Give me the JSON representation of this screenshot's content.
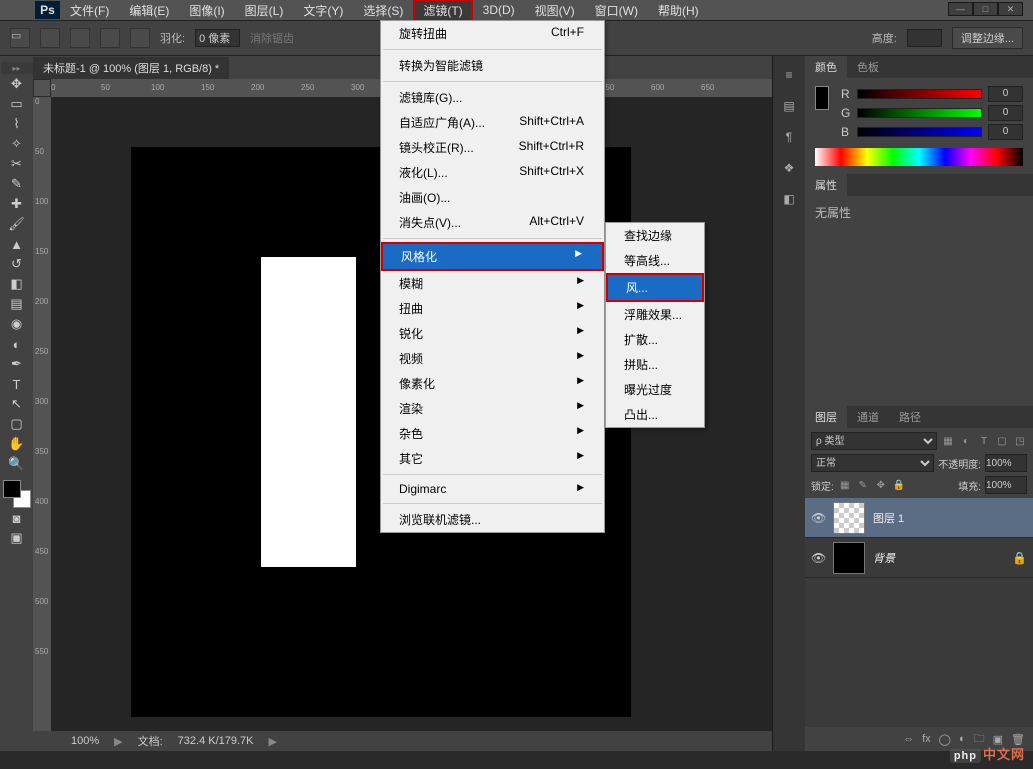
{
  "menubar": {
    "file": "文件(F)",
    "edit": "编辑(E)",
    "image": "图像(I)",
    "layer": "图层(L)",
    "type": "文字(Y)",
    "select": "选择(S)",
    "filter": "滤镜(T)",
    "threeD": "3D(D)",
    "view": "视图(V)",
    "window": "窗口(W)",
    "help": "帮助(H)"
  },
  "optbar": {
    "feather_label": "羽化:",
    "feather_value": "0 像素",
    "antialias": "消除锯齿",
    "altitude_label": "高度:",
    "refine_edge": "调整边缘..."
  },
  "doc": {
    "tab_title": "未标题-1 @ 100% (图层 1, RGB/8) *"
  },
  "status": {
    "zoom": "100%",
    "doc_label": "文档:",
    "doc_size": "732.4 K/179.7K"
  },
  "panels": {
    "color_tab": "颜色",
    "swatches_tab": "色板",
    "r": "R",
    "g": "G",
    "b": "B",
    "r_val": "0",
    "g_val": "0",
    "b_val": "0",
    "props_tab": "属性",
    "props_text": "无属性",
    "layers_tab": "图层",
    "channels_tab": "通道",
    "paths_tab": "路径",
    "kind_label": "类型",
    "kind_sel": "ρ 类型",
    "blend": "正常",
    "opacity_label": "不透明度:",
    "opacity_val": "100%",
    "lock_label": "锁定:",
    "fill_label": "填充:",
    "fill_val": "100%",
    "layer1": "图层 1",
    "bg": "背景"
  },
  "filter_menu": {
    "last": "旋转扭曲",
    "last_sc": "Ctrl+F",
    "smart": "转换为智能滤镜",
    "gallery": "滤镜库(G)...",
    "adaptive": "自适应广角(A)...",
    "adaptive_sc": "Shift+Ctrl+A",
    "lens": "镜头校正(R)...",
    "lens_sc": "Shift+Ctrl+R",
    "liquify": "液化(L)...",
    "liquify_sc": "Shift+Ctrl+X",
    "oil": "油画(O)...",
    "vanish": "消失点(V)...",
    "vanish_sc": "Alt+Ctrl+V",
    "stylize": "风格化",
    "blur": "模糊",
    "distort": "扭曲",
    "sharpen": "锐化",
    "video": "视频",
    "pixelate": "像素化",
    "render": "渲染",
    "noise": "杂色",
    "other": "其它",
    "digimarc": "Digimarc",
    "browse": "浏览联机滤镜..."
  },
  "stylize_menu": {
    "find_edges": "查找边缘",
    "contour": "等高线...",
    "wind": "风...",
    "emboss": "浮雕效果...",
    "diffuse": "扩散...",
    "tiles": "拼贴...",
    "glow": "曝光过度",
    "extrude": "凸出..."
  },
  "ruler_marks": [
    "0",
    "50",
    "100",
    "150",
    "200",
    "250",
    "300",
    "350",
    "400",
    "450",
    "500",
    "550",
    "600"
  ],
  "watermark": "中文网",
  "watermark_prefix": "php"
}
